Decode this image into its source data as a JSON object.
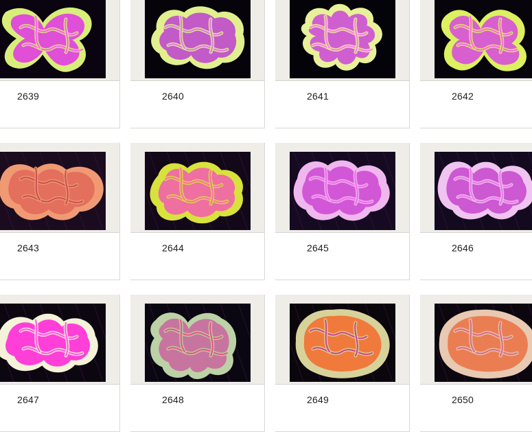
{
  "gallery": {
    "items": [
      {
        "id": "2639",
        "image_name": "coral-photo-2639",
        "colors": {
          "rim": "#d9ee7a",
          "mid": "#e04fd8",
          "core": "#ff5fe8",
          "bg": "#0a0410"
        }
      },
      {
        "id": "2640",
        "image_name": "coral-photo-2640",
        "colors": {
          "rim": "#e2ef8e",
          "mid": "#c25ac8",
          "core": "#e07be0",
          "bg": "#06030a"
        }
      },
      {
        "id": "2641",
        "image_name": "coral-photo-2641",
        "colors": {
          "rim": "#e9f09a",
          "mid": "#cf5fd0",
          "core": "#ff7de6",
          "bg": "#05030a"
        }
      },
      {
        "id": "2642",
        "image_name": "coral-photo-2642",
        "colors": {
          "rim": "#dcf060",
          "mid": "#d85fcf",
          "core": "#ff66e6",
          "bg": "#08040c"
        }
      },
      {
        "id": "2643",
        "image_name": "coral-photo-2643",
        "colors": {
          "rim": "#f09a74",
          "mid": "#e36f5d",
          "core": "#c9504d",
          "bg": "#1b0b1e"
        }
      },
      {
        "id": "2644",
        "image_name": "coral-photo-2644",
        "colors": {
          "rim": "#d8e23c",
          "mid": "#ee6fa0",
          "core": "#ff6ea6",
          "bg": "#120818"
        }
      },
      {
        "id": "2645",
        "image_name": "coral-photo-2645",
        "colors": {
          "rim": "#f0b7ef",
          "mid": "#d257d6",
          "core": "#f070ea",
          "bg": "#150a22"
        }
      },
      {
        "id": "2646",
        "image_name": "coral-photo-2646",
        "colors": {
          "rim": "#f0c3f0",
          "mid": "#cc58d2",
          "core": "#ea7ae6",
          "bg": "#130a20"
        }
      },
      {
        "id": "2647",
        "image_name": "coral-photo-2647",
        "colors": {
          "rim": "#f4f2d8",
          "mid": "#ff3fd8",
          "core": "#ff5ae3",
          "bg": "#0c0610"
        }
      },
      {
        "id": "2648",
        "image_name": "coral-photo-2648",
        "colors": {
          "rim": "#bcd2a6",
          "mid": "#c7759f",
          "core": "#e5577c",
          "bg": "#0a0712"
        }
      },
      {
        "id": "2649",
        "image_name": "coral-photo-2649",
        "colors": {
          "rim": "#d7d29a",
          "mid": "#ef7a3c",
          "core": "#c8468c",
          "bg": "#0a060c"
        }
      },
      {
        "id": "2650",
        "image_name": "coral-photo-2650",
        "colors": {
          "rim": "#e8c9b2",
          "mid": "#ea7e52",
          "core": "#d86a8a",
          "bg": "#0c070e"
        }
      }
    ]
  }
}
